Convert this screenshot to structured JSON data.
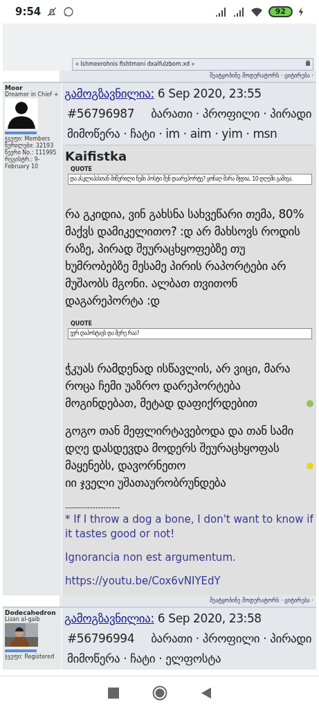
{
  "status_bar": {
    "time": "9:54",
    "battery": "92"
  },
  "previous_post": {
    "signature_link": "« Ishmeerohnis fishtmoni dxalfulzbom.xd »",
    "actions": [
      "შეატყობინე მოდერატორს",
      "ციტირება"
    ]
  },
  "separator": "·",
  "posts": [
    {
      "author": "Moor",
      "rank": "Dreamer in Chief +",
      "avatar": {
        "kind": "silhouette"
      },
      "stats": [
        "ჯგუფი: Members",
        "წერილები: 32193",
        "წევრი No.: 111995",
        "რეგისტრ.: 9-February 10"
      ],
      "posted_label": "გამოგზავნილია:",
      "date": "6 Sep 2020, 23:55",
      "number": "#56796987",
      "links": [
        "ბარათი",
        "პროფილი",
        "პირადი მიმოწერა",
        "ჩატი",
        "im",
        "aim",
        "yim",
        "msn"
      ],
      "title": "Kaifistka",
      "body": [
        {
          "kind": "quote",
          "label": "QUOTE",
          "text": "და ასკლიპასთან მიწერილი ჩემი პოსტი შენ დაარეპორტე? ყოჩაღ მარა მჯდია. 10 დღეში გამივა."
        },
        {
          "kind": "text",
          "text": "რა გკიდია, ვინ გახსნა სახვეწარი თემა, 80% მაქვს დამიკელითო? :დ არ მახსოვს როდის რაზე, პირად შეურაცხყოფებზე თუ ხუმრობებზე მესამე პირის რაპორტები არ მუშაობს მგონი. ალბათ თვითონ დაგარეპორტა :დ"
        },
        {
          "kind": "quote",
          "label": "QUOTE",
          "text": "ვერ დაპოსტავს და მერე რაა?"
        },
        {
          "kind": "text",
          "text": "ჭკუას რამდენად ისწავლის, არ ვიცი, მარა როცა ჩემი უაზრო დარეპორტება მოგინდებათ, მეტად დაფიქრდებით",
          "emoji": {
            "kind": "smile"
          }
        },
        {
          "kind": "text",
          "text": "გოგო თან მეფლირტავებოდა და თან სამი დღე დასდევდა მოდერს შეურაცხყოფას მაყენებს, დავორნეთო",
          "emoji": {
            "kind": "blush"
          },
          "after": "იი ჯველი უშათაურობრუნდება"
        }
      ],
      "signature": [
        "--------------------",
        "* If I throw a dog a bone, I don't want to know if it tastes good or not!",
        "Ignorancia non est argumentum.",
        "https://youtu.be/Cox6vNIYEdY"
      ],
      "actions": [
        "შეატყობინე მოდერატორს",
        "ციტირება"
      ]
    },
    {
      "author": "Dodecahedron",
      "rank": "Lisan al-gaib",
      "avatar": {
        "kind": "picture"
      },
      "stats": [
        "ჯგუფი: Registered"
      ],
      "posted_label": "გამოგზავნილია:",
      "date": "6 Sep 2020, 23:58",
      "number": "#56796994",
      "links": [
        "ბარათი",
        "პროფილი",
        "პირადი მიმოწერა",
        "ჩატი",
        "ელფოსტა"
      ]
    }
  ]
}
